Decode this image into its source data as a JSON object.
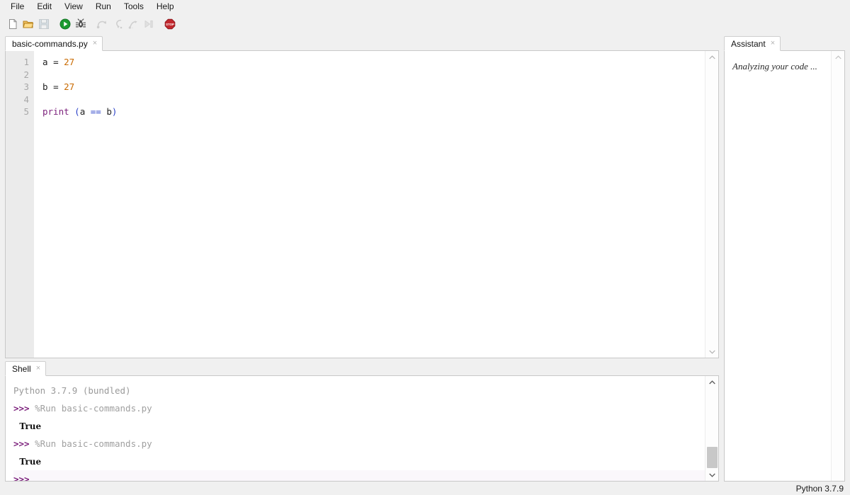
{
  "menubar": {
    "items": [
      {
        "label": "File",
        "name": "menu-file"
      },
      {
        "label": "Edit",
        "name": "menu-edit"
      },
      {
        "label": "View",
        "name": "menu-view"
      },
      {
        "label": "Run",
        "name": "menu-run"
      },
      {
        "label": "Tools",
        "name": "menu-tools"
      },
      {
        "label": "Help",
        "name": "menu-help"
      }
    ]
  },
  "toolbar": {
    "buttons": [
      {
        "icon": "new-file-icon",
        "label": "New",
        "enabled": true
      },
      {
        "icon": "open-folder-icon",
        "label": "Open",
        "enabled": true
      },
      {
        "icon": "save-icon",
        "label": "Save",
        "enabled": false
      },
      {
        "icon": "run-icon",
        "label": "Run current script",
        "enabled": true
      },
      {
        "icon": "debug-icon",
        "label": "Debug current script",
        "enabled": true
      },
      {
        "icon": "step-over-icon",
        "label": "Step over",
        "enabled": false
      },
      {
        "icon": "step-into-icon",
        "label": "Step into",
        "enabled": false
      },
      {
        "icon": "step-out-icon",
        "label": "Step out",
        "enabled": false
      },
      {
        "icon": "resume-icon",
        "label": "Resume",
        "enabled": false
      },
      {
        "icon": "stop-icon",
        "label": "Stop/Restart backend",
        "enabled": true
      }
    ]
  },
  "editor": {
    "tab": {
      "label": "basic-commands.py",
      "close": "×"
    },
    "line_numbers": [
      "1",
      "2",
      "3",
      "4",
      "5"
    ],
    "lines": [
      {
        "tokens": [
          {
            "t": "a ",
            "c": "tok-var"
          },
          {
            "t": "= ",
            "c": "tok-var"
          },
          {
            "t": "27",
            "c": "tok-num"
          }
        ]
      },
      {
        "tokens": [
          {
            "t": "",
            "c": "tok-var"
          }
        ]
      },
      {
        "tokens": [
          {
            "t": "b ",
            "c": "tok-var"
          },
          {
            "t": "= ",
            "c": "tok-var"
          },
          {
            "t": "27",
            "c": "tok-num"
          }
        ]
      },
      {
        "tokens": [
          {
            "t": "",
            "c": "tok-var"
          }
        ]
      },
      {
        "tokens": [
          {
            "t": "print ",
            "c": "tok-kw"
          },
          {
            "t": "(",
            "c": "tok-op"
          },
          {
            "t": "a ",
            "c": "tok-var"
          },
          {
            "t": "== ",
            "c": "tok-op"
          },
          {
            "t": "b",
            "c": "tok-var"
          },
          {
            "t": ")",
            "c": "tok-op"
          }
        ]
      }
    ],
    "plain_text": "a = 27\n\nb = 27\n\nprint (a == b)"
  },
  "assistant": {
    "tab": {
      "label": "Assistant",
      "close": "×"
    },
    "message": "Analyzing your code ..."
  },
  "shell": {
    "tab": {
      "label": "Shell",
      "close": "×"
    },
    "lines": [
      {
        "kind": "sys",
        "prompt": "",
        "text": "Python 3.7.9 (bundled)"
      },
      {
        "kind": "cmd",
        "prompt": ">>>",
        "text": "%Run basic-commands.py"
      },
      {
        "kind": "out",
        "prompt": "",
        "text": "True"
      },
      {
        "kind": "cmd",
        "prompt": ">>>",
        "text": "%Run basic-commands.py"
      },
      {
        "kind": "out",
        "prompt": "",
        "text": "True"
      },
      {
        "kind": "active",
        "prompt": ">>>",
        "text": ""
      }
    ]
  },
  "statusbar": {
    "interpreter": "Python 3.7.9"
  },
  "colors": {
    "window_bg": "#f0f0f0",
    "panel_bg": "#ffffff",
    "gutter_bg": "#ebebeb",
    "accent_keyword": "#7b1f7b",
    "accent_number": "#c96a00",
    "accent_operator": "#2a41c8",
    "run_green": "#1c9a30",
    "stop_red": "#c1272d",
    "folder_yellow": "#e3a428"
  }
}
